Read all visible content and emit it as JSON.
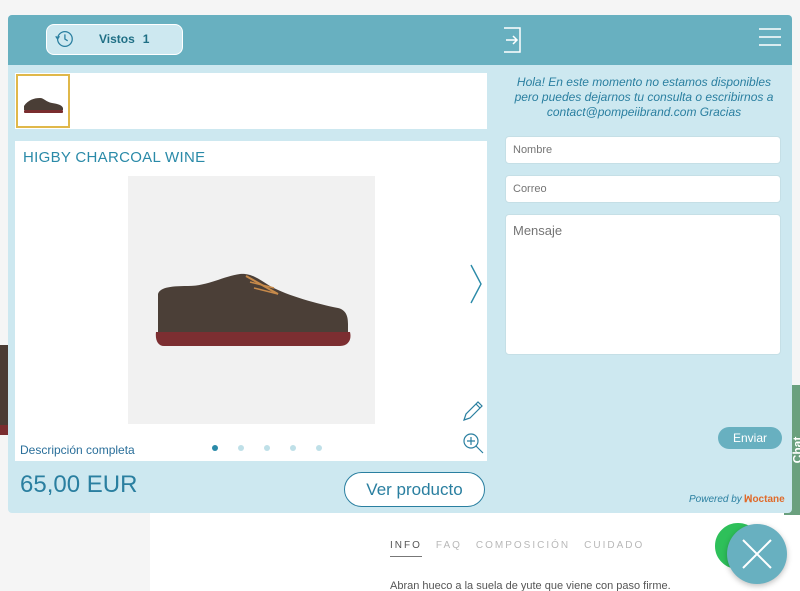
{
  "header": {
    "vistos_label": "Vistos",
    "vistos_count": "1"
  },
  "product": {
    "title": "HIGBY CHARCOAL WINE",
    "description_link": "Descripción completa",
    "price": "65,00 EUR",
    "view_button": "Ver producto",
    "carousel_dots": 5,
    "active_dot": 1
  },
  "contact": {
    "message": "Hola! En este momento no estamos disponibles pero puedes dejarnos tu consulta o escribirnos a contact@pompeiibrand.com Gracias",
    "name_placeholder": "Nombre",
    "email_placeholder": "Correo",
    "message_placeholder": "Mensaje",
    "send_button": "Enviar",
    "powered_by": "Powered by",
    "powered_brand": "octane"
  },
  "background_page": {
    "tabs": [
      "INFO",
      "FAQ",
      "COMPOSICIÓN",
      "CUIDADO"
    ],
    "active_tab": "INFO",
    "description_snippet": "Abran hueco a la suela de yute que viene con paso firme.",
    "chat_tab_label": "Chat"
  },
  "colors": {
    "accent": "#68b0c0",
    "panel": "#cde8f0",
    "text_blue": "#2a7fa0",
    "whatsapp": "#2ec05a"
  },
  "icons": {
    "history": "history-icon",
    "exit": "exit-icon",
    "menu": "hamburger-menu-icon",
    "next": "chevron-right-icon",
    "edit": "pencil-icon",
    "zoom": "zoom-in-icon",
    "close": "close-icon",
    "whatsapp": "whatsapp-icon"
  }
}
